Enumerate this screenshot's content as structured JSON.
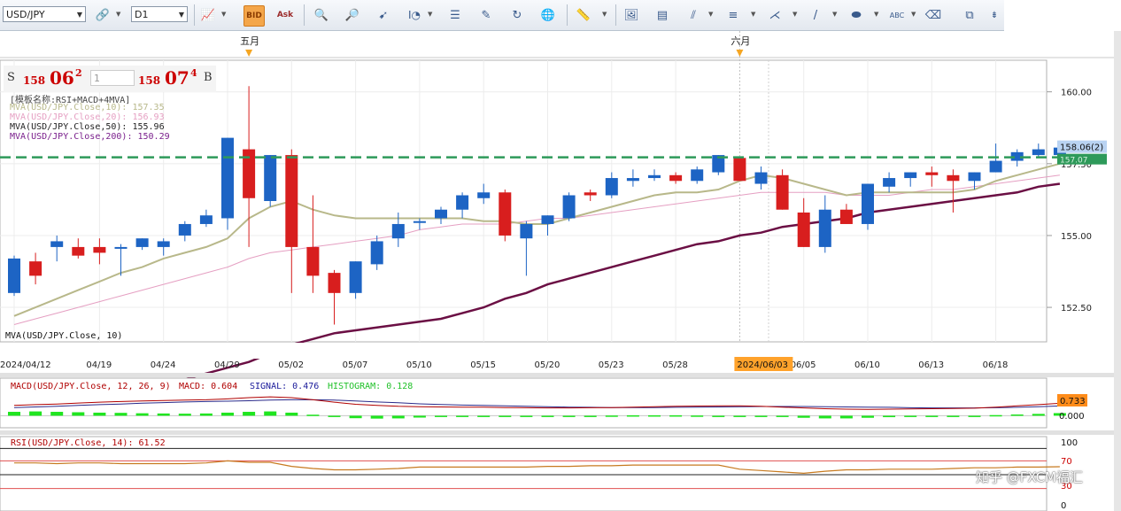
{
  "toolbar": {
    "symbol": "USD/JPY",
    "timeframe": "D1",
    "icons": [
      "chart-type-icon",
      "bar-chart-icon",
      "candle-chart-icon",
      "zoom-in-icon",
      "zoom-out-icon",
      "cursor-icon",
      "indicator-icon",
      "crosshair-icon",
      "properties-icon",
      "refresh-icon",
      "globe-icon",
      "ruler-icon",
      "image-icon",
      "template-icon",
      "lines-icon",
      "bars-icon",
      "pen-icon",
      "draw-icon",
      "ellipse-icon",
      "text-icon",
      "eraser-icon",
      "tree-icon",
      "scroll-icon"
    ]
  },
  "quote": {
    "sell_label": "S",
    "sell_small": "158",
    "sell_big": "06",
    "sell_sup": "2",
    "lot": "1",
    "buy_small": "158",
    "buy_big": "07",
    "buy_sup": "4",
    "buy_label": "B"
  },
  "legend": {
    "template": "[模板名称:RSI+MACD+4MVA]",
    "mva10": "MVA(USD/JPY.Close,10): 157.35",
    "mva20": "MVA(USD/JPY.Close,20): 156.93",
    "mva50": "MVA(USD/JPY.Close,50): 155.96",
    "mva200": "MVA(USD/JPY.Close,200): 150.29",
    "bottom_label": "MVA(USD/JPY.Close, 10)"
  },
  "macd": {
    "label_a": "MACD(USD/JPY.Close, 12, 26, 9)",
    "label_b": "MACD: 0.604",
    "label_c": "SIGNAL: 0.476",
    "label_d": "HISTOGRAM: 0.128",
    "price_tag": "0.733",
    "zero_label": "0.000"
  },
  "rsi": {
    "label": "RSI(USD/JPY.Close, 14): 61.52",
    "levels": [
      "100",
      "70",
      "30",
      "0"
    ]
  },
  "watermark": "知乎 @FXCM福汇",
  "colors": {
    "bull": "#1d64c4",
    "bear": "#d81e1e",
    "mva10": "#b8b88a",
    "mva20": "#e59fc2",
    "mva50": "#6b0f44",
    "dashed": "#2e9a5a"
  },
  "chart_data": {
    "type": "candlestick",
    "symbol": "USD/JPY",
    "timeframe": "D1",
    "ylim": [
      151.3,
      161.1
    ],
    "y_ticks": [
      "160.00",
      "157.50",
      "155.00",
      "152.50"
    ],
    "x_labels": [
      "2024/04/12",
      "04/19",
      "04/24",
      "04/29",
      "05/02",
      "05/07",
      "05/10",
      "05/15",
      "05/20",
      "05/23",
      "05/28",
      "06/05",
      "06/10",
      "06/13",
      "06/18"
    ],
    "x_label_idx": [
      0,
      4,
      7,
      10,
      13,
      16,
      19,
      22,
      25,
      28,
      31,
      37,
      40,
      43,
      46
    ],
    "month_labels": [
      "五月",
      "六月"
    ],
    "month_label_idx": [
      11,
      34
    ],
    "cursor_label": "2024/06/03",
    "cursor_idx": 34,
    "current_price": "158.06(2)",
    "current_price_value": 158.06,
    "ask_price": "157.07",
    "ask_price_value": 157.72,
    "candles": [
      [
        153.0,
        154.3,
        152.9,
        154.2
      ],
      [
        154.1,
        154.4,
        153.3,
        153.6
      ],
      [
        154.6,
        155.0,
        154.1,
        154.8
      ],
      [
        154.6,
        154.9,
        154.2,
        154.3
      ],
      [
        154.6,
        154.9,
        154.0,
        154.4
      ],
      [
        154.6,
        154.7,
        153.6,
        154.6
      ],
      [
        154.6,
        154.9,
        154.5,
        154.9
      ],
      [
        154.6,
        154.9,
        154.3,
        154.8
      ],
      [
        155.0,
        155.5,
        154.8,
        155.4
      ],
      [
        155.4,
        155.9,
        155.3,
        155.7
      ],
      [
        155.6,
        158.4,
        155.2,
        158.4
      ],
      [
        158.0,
        160.2,
        154.6,
        156.3
      ],
      [
        156.2,
        157.8,
        156.0,
        157.8
      ],
      [
        157.8,
        158.0,
        153.0,
        154.6
      ],
      [
        154.6,
        156.4,
        153.0,
        153.6
      ],
      [
        153.7,
        153.8,
        151.9,
        153.0
      ],
      [
        153.0,
        154.1,
        152.8,
        154.1
      ],
      [
        154.0,
        155.0,
        153.8,
        154.8
      ],
      [
        154.9,
        155.8,
        154.6,
        155.4
      ],
      [
        155.5,
        155.6,
        155.2,
        155.5
      ],
      [
        155.6,
        156.0,
        155.4,
        155.9
      ],
      [
        155.9,
        156.5,
        155.6,
        156.4
      ],
      [
        156.3,
        156.8,
        156.1,
        156.5
      ],
      [
        156.5,
        156.6,
        154.8,
        155.0
      ],
      [
        154.9,
        155.5,
        153.6,
        155.4
      ],
      [
        155.4,
        155.7,
        155.0,
        155.7
      ],
      [
        155.6,
        156.5,
        155.5,
        156.4
      ],
      [
        156.5,
        156.6,
        156.2,
        156.4
      ],
      [
        156.4,
        157.2,
        156.3,
        157.0
      ],
      [
        156.9,
        157.3,
        156.7,
        157.0
      ],
      [
        157.0,
        157.3,
        156.9,
        157.1
      ],
      [
        157.1,
        157.2,
        156.8,
        156.9
      ],
      [
        156.9,
        157.4,
        156.8,
        157.3
      ],
      [
        157.2,
        157.8,
        157.1,
        157.8
      ],
      [
        157.7,
        157.7,
        156.9,
        156.9
      ],
      [
        156.8,
        157.4,
        156.6,
        157.2
      ],
      [
        157.1,
        157.3,
        155.9,
        155.9
      ],
      [
        155.8,
        156.3,
        154.6,
        154.6
      ],
      [
        154.6,
        156.4,
        154.4,
        155.9
      ],
      [
        155.9,
        156.1,
        155.4,
        155.4
      ],
      [
        155.4,
        156.8,
        155.2,
        156.8
      ],
      [
        156.7,
        157.2,
        156.5,
        157.0
      ],
      [
        157.0,
        157.2,
        156.7,
        157.2
      ],
      [
        157.2,
        157.4,
        156.7,
        157.1
      ],
      [
        157.1,
        157.3,
        155.8,
        156.9
      ],
      [
        156.9,
        157.2,
        156.6,
        157.2
      ],
      [
        157.2,
        158.2,
        157.2,
        157.6
      ],
      [
        157.6,
        158.0,
        157.4,
        157.9
      ],
      [
        157.8,
        158.2,
        157.7,
        158.0
      ],
      [
        157.8,
        158.3,
        157.7,
        158.06
      ]
    ],
    "mva10": [
      152.2,
      152.5,
      152.8,
      153.1,
      153.4,
      153.7,
      153.9,
      154.2,
      154.4,
      154.6,
      154.9,
      155.6,
      156.0,
      156.2,
      155.9,
      155.7,
      155.6,
      155.6,
      155.6,
      155.6,
      155.6,
      155.6,
      155.5,
      155.5,
      155.4,
      155.4,
      155.6,
      155.8,
      156.0,
      156.2,
      156.4,
      156.5,
      156.5,
      156.6,
      156.9,
      157.1,
      157.0,
      156.8,
      156.6,
      156.4,
      156.5,
      156.5,
      156.5,
      156.5,
      156.5,
      156.6,
      156.9,
      157.1,
      157.3,
      157.5
    ],
    "mva20": [
      151.9,
      152.1,
      152.3,
      152.5,
      152.7,
      152.9,
      153.1,
      153.3,
      153.5,
      153.7,
      153.9,
      154.2,
      154.4,
      154.5,
      154.6,
      154.7,
      154.8,
      154.9,
      155.0,
      155.2,
      155.3,
      155.4,
      155.4,
      155.4,
      155.5,
      155.6,
      155.6,
      155.7,
      155.8,
      155.9,
      156.0,
      156.1,
      156.2,
      156.3,
      156.4,
      156.5,
      156.5,
      156.5,
      156.5,
      156.4,
      156.4,
      156.4,
      156.5,
      156.6,
      156.6,
      156.7,
      156.8,
      156.9,
      157.0,
      157.1
    ],
    "mva50": [
      148.6,
      148.8,
      148.9,
      149.1,
      149.3,
      149.5,
      149.6,
      149.8,
      150.0,
      150.2,
      150.4,
      150.6,
      150.9,
      151.2,
      151.4,
      151.6,
      151.7,
      151.8,
      151.9,
      152.0,
      152.1,
      152.3,
      152.5,
      152.8,
      153.0,
      153.3,
      153.5,
      153.7,
      153.9,
      154.1,
      154.3,
      154.5,
      154.7,
      154.8,
      155.0,
      155.1,
      155.3,
      155.4,
      155.5,
      155.6,
      155.8,
      155.9,
      156.0,
      156.1,
      156.2,
      156.3,
      156.4,
      156.5,
      156.7,
      156.8
    ],
    "macd_hist": [
      0.19,
      0.21,
      0.19,
      0.17,
      0.15,
      0.14,
      0.12,
      0.11,
      0.1,
      0.11,
      0.15,
      0.19,
      0.21,
      0.15,
      0.05,
      -0.05,
      -0.12,
      -0.14,
      -0.13,
      -0.09,
      -0.06,
      -0.03,
      -0.01,
      -0.03,
      -0.04,
      -0.03,
      -0.01,
      0.0,
      0.01,
      0.02,
      0.02,
      0.02,
      0.01,
      0.0,
      0.0,
      -0.02,
      -0.06,
      -0.1,
      -0.13,
      -0.13,
      -0.1,
      -0.07,
      -0.04,
      -0.02,
      -0.01,
      0.0,
      0.03,
      0.06,
      0.09,
      0.128
    ],
    "macd_line": [
      0.5,
      0.54,
      0.57,
      0.62,
      0.66,
      0.69,
      0.72,
      0.74,
      0.76,
      0.78,
      0.82,
      0.88,
      0.92,
      0.88,
      0.78,
      0.66,
      0.56,
      0.5,
      0.46,
      0.44,
      0.43,
      0.42,
      0.42,
      0.4,
      0.39,
      0.38,
      0.38,
      0.39,
      0.4,
      0.42,
      0.44,
      0.46,
      0.47,
      0.48,
      0.48,
      0.46,
      0.42,
      0.38,
      0.34,
      0.32,
      0.31,
      0.32,
      0.33,
      0.34,
      0.35,
      0.37,
      0.42,
      0.48,
      0.54,
      0.604
    ],
    "signal_line": [
      0.4,
      0.43,
      0.46,
      0.5,
      0.54,
      0.57,
      0.61,
      0.64,
      0.67,
      0.69,
      0.71,
      0.73,
      0.76,
      0.78,
      0.78,
      0.76,
      0.72,
      0.67,
      0.63,
      0.58,
      0.55,
      0.52,
      0.5,
      0.48,
      0.46,
      0.44,
      0.42,
      0.41,
      0.4,
      0.4,
      0.4,
      0.41,
      0.42,
      0.43,
      0.44,
      0.45,
      0.45,
      0.45,
      0.44,
      0.43,
      0.42,
      0.41,
      0.39,
      0.38,
      0.38,
      0.38,
      0.39,
      0.41,
      0.44,
      0.476
    ],
    "macd_ylim": [
      -0.5,
      1.4
    ],
    "rsi": [
      67,
      67,
      66,
      67,
      67,
      66,
      66,
      66,
      66,
      67,
      70,
      68,
      68,
      62,
      59,
      57,
      57,
      58,
      59,
      61,
      61,
      61,
      61,
      61,
      61,
      62,
      62,
      63,
      63,
      64,
      64,
      64,
      64,
      64,
      58,
      56,
      54,
      52,
      55,
      57,
      57,
      58,
      58,
      58,
      59,
      60,
      60,
      61,
      61,
      61.52
    ]
  }
}
